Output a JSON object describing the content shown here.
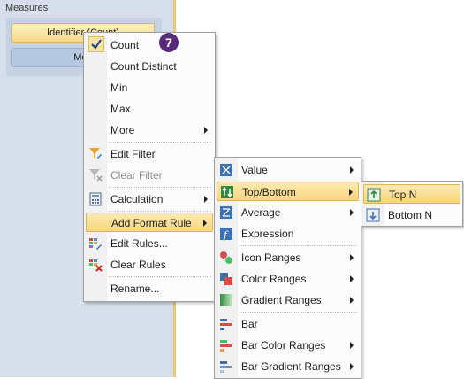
{
  "panel": {
    "title": "Measures",
    "measure1": "Identifier (Count)",
    "measure2": "Mea"
  },
  "badge": "7",
  "context_menu": {
    "count": "Count",
    "count_distinct": "Count Distinct",
    "min": "Min",
    "max": "Max",
    "more": "More",
    "edit_filter": "Edit Filter",
    "clear_filter": "Clear Filter",
    "calculation": "Calculation",
    "add_format_rule": "Add Format Rule",
    "edit_rules": "Edit Rules...",
    "clear_rules": "Clear Rules",
    "rename": "Rename..."
  },
  "format_menu": {
    "value": "Value",
    "top_bottom": "Top/Bottom",
    "average": "Average",
    "expression": "Expression",
    "icon_ranges": "Icon Ranges",
    "color_ranges": "Color Ranges",
    "gradient_ranges": "Gradient Ranges",
    "bar": "Bar",
    "bar_color_ranges": "Bar Color Ranges",
    "bar_gradient_ranges": "Bar Gradient Ranges"
  },
  "topbottom_menu": {
    "top_n": "Top N",
    "bottom_n": "Bottom N"
  }
}
